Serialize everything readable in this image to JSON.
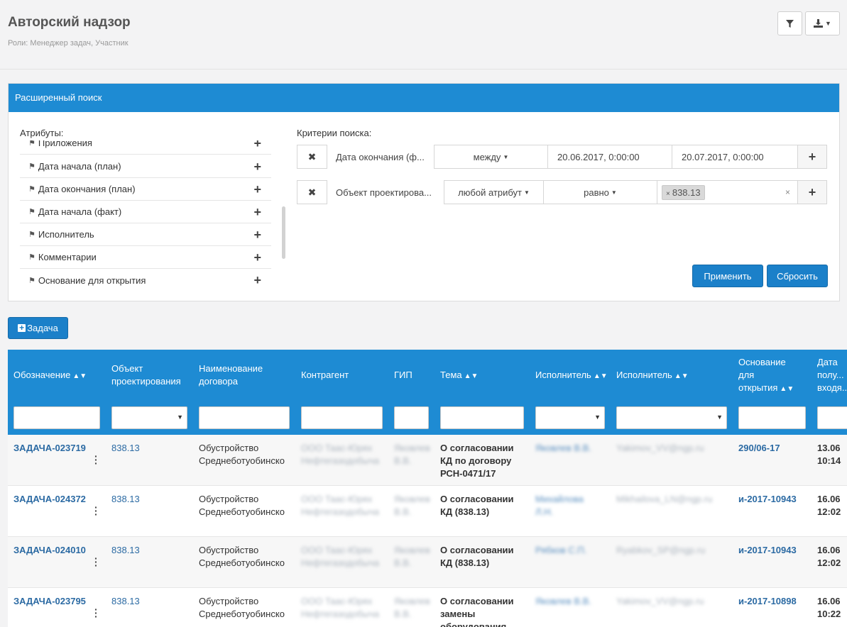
{
  "header": {
    "title": "Авторский надзор",
    "roles": "Роли: Менеджер задач, Участник"
  },
  "search": {
    "panel_title": "Расширенный поиск",
    "attributes_label": "Атрибуты:",
    "criteria_label": "Критерии поиска:",
    "attributes": [
      "Приложения",
      "Дата начала (план)",
      "Дата окончания (план)",
      "Дата начала (факт)",
      "Исполнитель",
      "Комментарии",
      "Основание для открытия"
    ],
    "criteria": [
      {
        "name": "Дата окончания (ф...",
        "operator": "между",
        "from": "20.06.2017, 0:00:00",
        "to": "20.07.2017, 0:00:00"
      },
      {
        "name": "Объект проектирова...",
        "attribute": "любой атрибут",
        "operator": "равно",
        "value": "838.13"
      }
    ],
    "apply_label": "Применить",
    "reset_label": "Сбросить"
  },
  "toolbar": {
    "task_label": "Задача"
  },
  "table": {
    "columns": [
      "Обозначение",
      "Объект проектирования",
      "Наименование договора",
      "Контрагент",
      "ГИП",
      "Тема",
      "Исполнитель",
      "Исполнитель",
      "Основание для открытия",
      "Дата полу... входя..."
    ],
    "rows": [
      {
        "id": "ЗАДАЧА-023719",
        "object": "838.13",
        "contract": "Обустройство Среднеботуобинско",
        "contractor": "ООО Таас-Юрях Нефтегазодобыча",
        "gip": "Яковлев В.В.",
        "topic": "О согласовании КД по договору РСН-0471/17",
        "executor": "Яковлев В.В.",
        "executor_email": "Yakimov_VV@ngp.ru",
        "basis": "290/06-17",
        "date": "13.06",
        "time": "10:14"
      },
      {
        "id": "ЗАДАЧА-024372",
        "object": "838.13",
        "contract": "Обустройство Среднеботуобинско",
        "contractor": "ООО Таас-Юрях Нефтегазодобыча",
        "gip": "Яковлев В.В.",
        "topic": "О согласовании КД (838.13)",
        "executor": "Михайлова Л.Н.",
        "executor_email": "Mikhailova_LN@ngp.ru",
        "basis": "и-2017-10943",
        "date": "16.06",
        "time": "12:02"
      },
      {
        "id": "ЗАДАЧА-024010",
        "object": "838.13",
        "contract": "Обустройство Среднеботуобинско",
        "contractor": "ООО Таас-Юрях Нефтегазодобыча",
        "gip": "Яковлев В.В.",
        "topic": "О согласовании КД (838.13)",
        "executor": "Рябков С.П.",
        "executor_email": "Ryabkov_SP@ngp.ru",
        "basis": "и-2017-10943",
        "date": "16.06",
        "time": "12:02"
      },
      {
        "id": "ЗАДАЧА-023795",
        "object": "838.13",
        "contract": "Обустройство Среднеботуобинско",
        "contractor": "ООО Таас-Юрях Нефтегазодобыча",
        "gip": "Яковлев В.В.",
        "topic": "О согласовании замены оборудования",
        "executor": "Яковлев В.В.",
        "executor_email": "Yakimov_VV@ngp.ru",
        "basis": "и-2017-10898",
        "date": "16.06",
        "time": "10:22"
      }
    ]
  },
  "colors": {
    "accent": "#1e8bd3",
    "button": "#1b80c9",
    "link": "#2b6aa3"
  }
}
